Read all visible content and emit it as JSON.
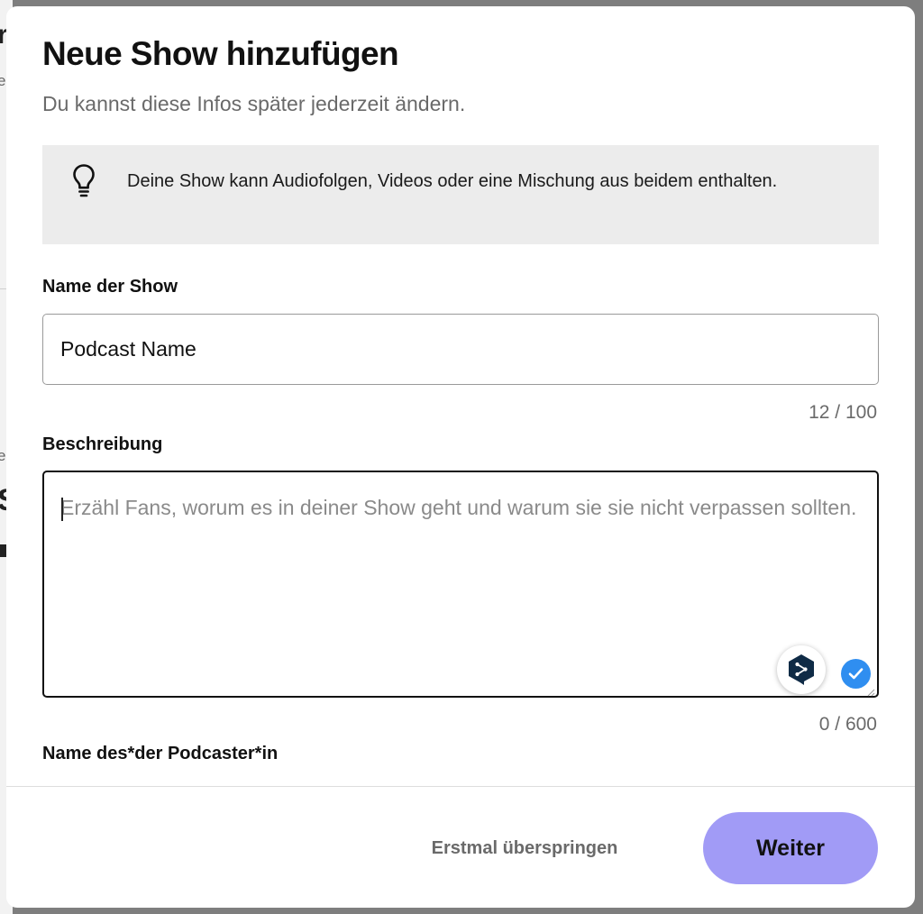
{
  "background_page": {
    "fragments": [
      "r",
      "e",
      "ei",
      "S"
    ]
  },
  "modal": {
    "title": "Neue Show hinzufügen",
    "subtitle": "Du kannst diese Infos später jederzeit ändern.",
    "info_box": {
      "icon": "lightbulb-icon",
      "text": "Deine Show kann Audiofolgen, Videos oder eine Mischung aus beidem enthalten."
    },
    "show_name": {
      "label": "Name der Show",
      "value": "Podcast Name",
      "counter": "12 / 100"
    },
    "description": {
      "label": "Beschreibung",
      "value": "",
      "placeholder": "Erzähl Fans, worum es in deiner Show geht und warum sie sie nicht verpassen sollten.",
      "counter": "0 / 600",
      "extension_icons": [
        "deepl-translate-icon",
        "checkmark-icon"
      ]
    },
    "podcaster_name": {
      "label": "Name des*der Podcaster*in"
    },
    "footer": {
      "skip_label": "Erstmal überspringen",
      "next_label": "Weiter"
    }
  },
  "colors": {
    "overlay": "#7e7e7e",
    "info_box_bg": "#ececec",
    "primary_button": "#a19bf6",
    "badge_blue": "#2f8ef0",
    "deepl_navy": "#0f2b46"
  }
}
